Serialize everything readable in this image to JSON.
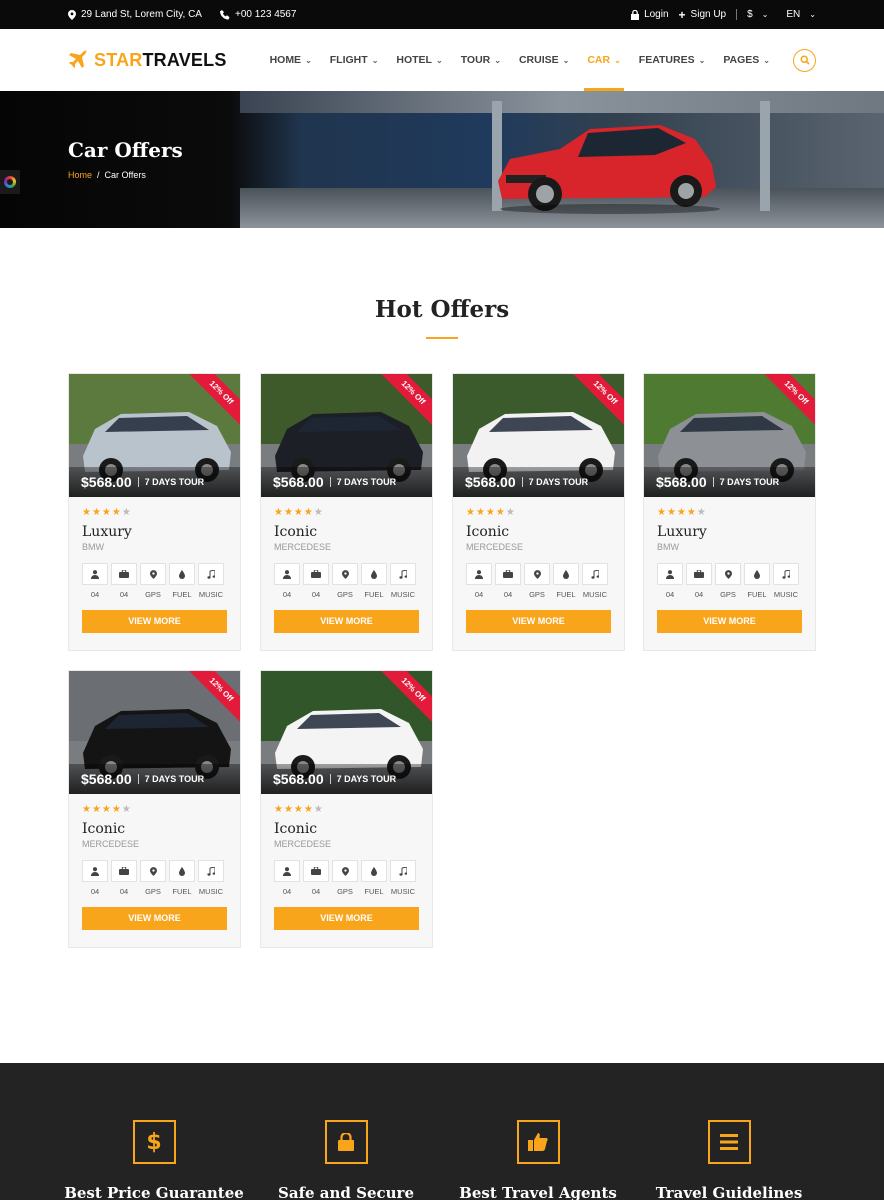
{
  "topbar": {
    "address": "29 Land St, Lorem City, CA",
    "phone": "+00 123 4567",
    "login": "Login",
    "signup": "Sign Up",
    "currency": "$",
    "language": "EN"
  },
  "brand": {
    "star": "STAR",
    "travels": "TRAVELS"
  },
  "nav": [
    {
      "label": "HOME"
    },
    {
      "label": "FLIGHT"
    },
    {
      "label": "HOTEL"
    },
    {
      "label": "TOUR"
    },
    {
      "label": "CRUISE"
    },
    {
      "label": "CAR"
    },
    {
      "label": "FEATURES"
    },
    {
      "label": "PAGES"
    }
  ],
  "banner": {
    "title": "Car Offers",
    "breadcrumb_home": "Home",
    "breadcrumb_sep": "/",
    "breadcrumb_current": "Car Offers"
  },
  "section": {
    "title": "Hot Offers"
  },
  "cards": [
    {
      "badge": "12% Off",
      "price": "$568.00",
      "duration": "7 DAYS TOUR",
      "rating": 4,
      "name": "Luxury",
      "brand": "BMW",
      "car_color": "#b9c3cc",
      "bg": "#5d7a3e"
    },
    {
      "badge": "12% Off",
      "price": "$568.00",
      "duration": "7 DAYS TOUR",
      "rating": 4,
      "name": "Iconic",
      "brand": "MERCEDESE",
      "car_color": "#1c1f26",
      "bg": "#3e5a2a"
    },
    {
      "badge": "12% Off",
      "price": "$568.00",
      "duration": "7 DAYS TOUR",
      "rating": 4,
      "name": "Iconic",
      "brand": "MERCEDESE",
      "car_color": "#f2f2f2",
      "bg": "#3b5b2c"
    },
    {
      "badge": "12% Off",
      "price": "$568.00",
      "duration": "7 DAYS TOUR",
      "rating": 4,
      "name": "Luxury",
      "brand": "BMW",
      "car_color": "#8d9196",
      "bg": "#4e7a32"
    },
    {
      "badge": "12% Off",
      "price": "$568.00",
      "duration": "7 DAYS TOUR",
      "rating": 4,
      "name": "Iconic",
      "brand": "MERCEDESE",
      "car_color": "#141414",
      "bg": "#6b6e73"
    },
    {
      "badge": "12% Off",
      "price": "$568.00",
      "duration": "7 DAYS TOUR",
      "rating": 4,
      "name": "Iconic",
      "brand": "MERCEDESE",
      "car_color": "#f4f4f4",
      "bg": "#31562a"
    }
  ],
  "features": [
    {
      "icon": "user-icon",
      "label": "04"
    },
    {
      "icon": "briefcase-icon",
      "label": "04"
    },
    {
      "icon": "map-pin-icon",
      "label": "GPS"
    },
    {
      "icon": "fuel-drop-icon",
      "label": "FUEL"
    },
    {
      "icon": "music-icon",
      "label": "MUSIC"
    }
  ],
  "view_more": "VIEW MORE",
  "footer": [
    {
      "icon": "dollar-icon",
      "title": "Best Price Guarantee"
    },
    {
      "icon": "lock-icon",
      "title": "Safe and Secure"
    },
    {
      "icon": "thumbs-up-icon",
      "title": "Best Travel Agents"
    },
    {
      "icon": "list-icon",
      "title": "Travel Guidelines"
    }
  ],
  "colors": {
    "accent": "#f8a51b",
    "ribbon": "#e31b3a",
    "footer_bg": "#232323"
  }
}
